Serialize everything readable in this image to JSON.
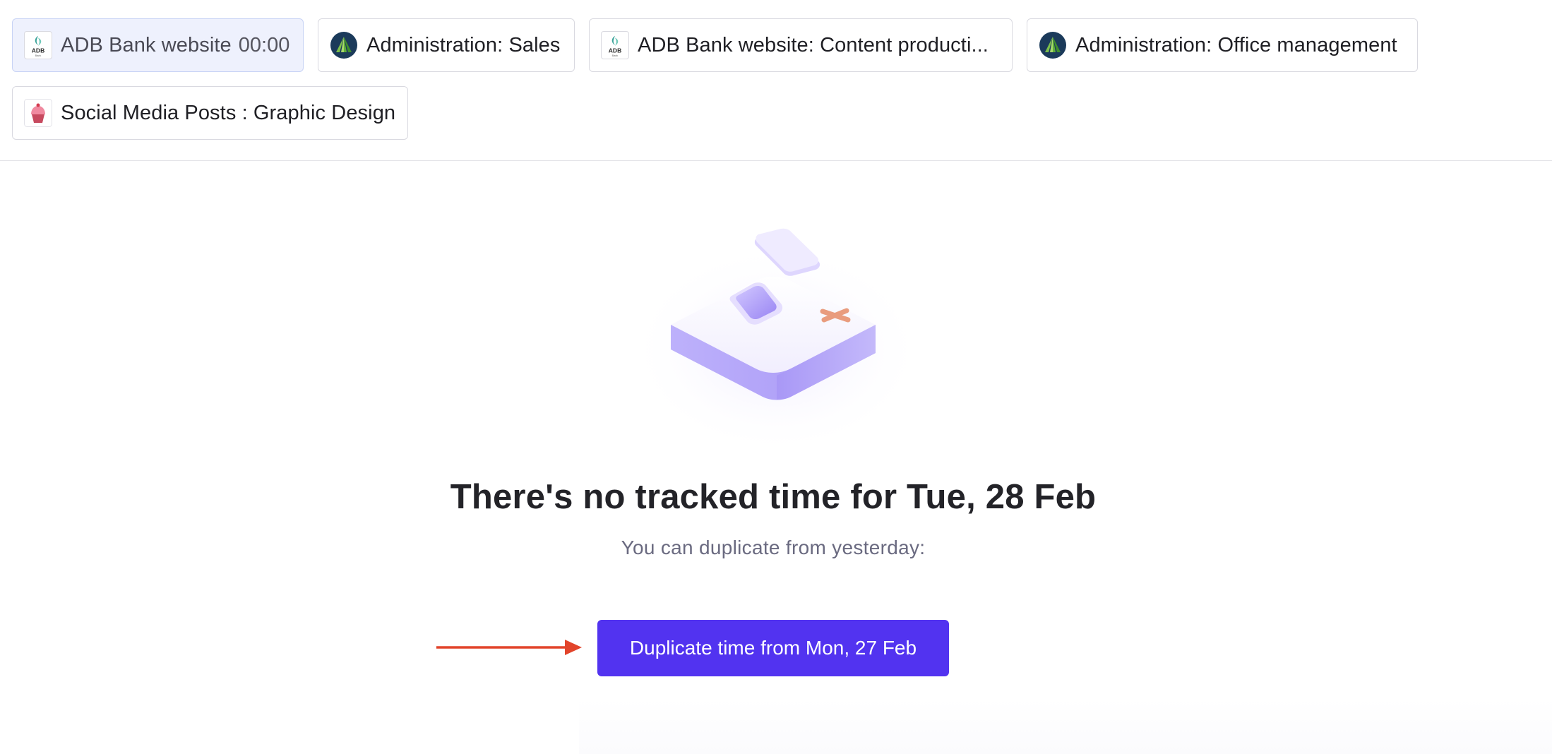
{
  "recent_entries": [
    {
      "label": "ADB Bank website",
      "timer": "00:00",
      "logo": "adb-bank-logo",
      "active": true
    },
    {
      "label": "Administration: Sales",
      "logo": "administration-logo"
    },
    {
      "label": "ADB Bank website: Content producti...",
      "logo": "adb-bank-logo"
    },
    {
      "label": "Administration: Office management",
      "logo": "administration-logo"
    },
    {
      "label": "Social Media Posts : Graphic Design",
      "logo": "cupcake-logo"
    }
  ],
  "adb_logo_text": {
    "main": "ADB",
    "small": "Bank"
  },
  "empty_state": {
    "title": "There's no tracked time for Tue, 28 Feb",
    "subtitle": "You can duplicate from yesterday:",
    "button_label": "Duplicate time from Mon, 27 Feb"
  },
  "colors": {
    "accent": "#5233f0",
    "arrow": "#e2442b",
    "active_chip_bg": "#eef1fd"
  }
}
